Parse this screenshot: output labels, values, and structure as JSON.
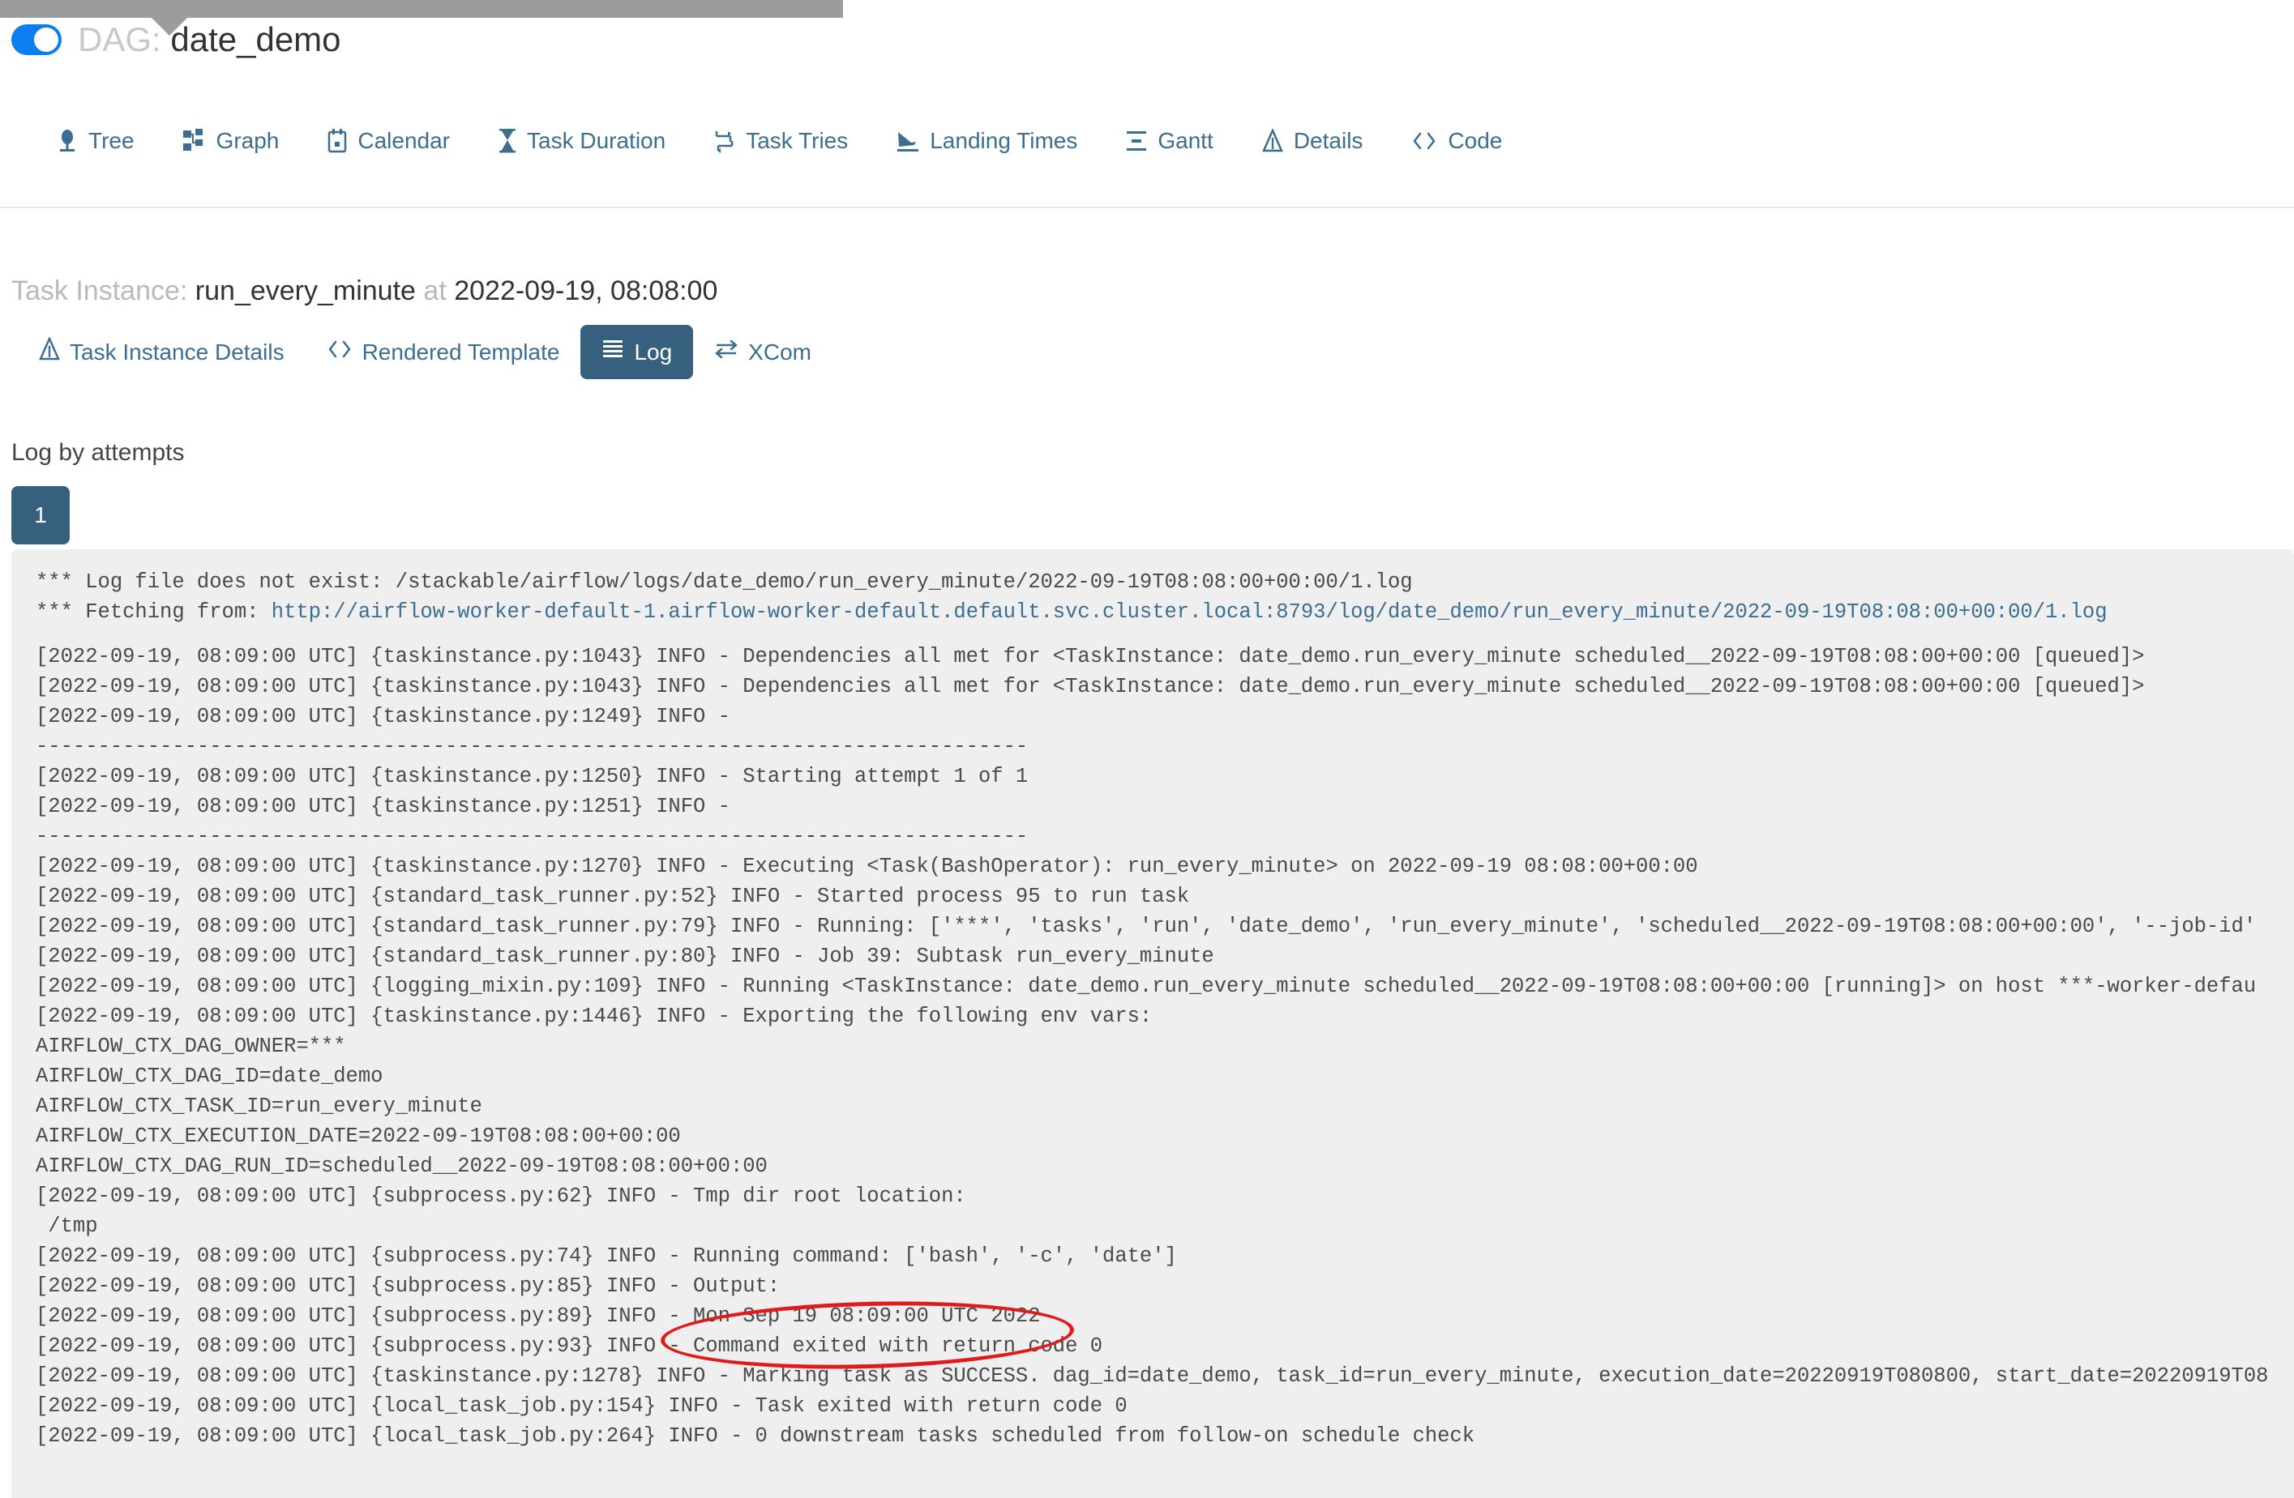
{
  "tooltip": {
    "visible": true
  },
  "dag": {
    "toggle_state": "on",
    "label_prefix": "DAG:",
    "name": "date_demo"
  },
  "nav_tabs": [
    {
      "label": "Tree",
      "icon": "tree-icon"
    },
    {
      "label": "Graph",
      "icon": "graph-icon"
    },
    {
      "label": "Calendar",
      "icon": "calendar-icon"
    },
    {
      "label": "Task Duration",
      "icon": "hourglass-icon"
    },
    {
      "label": "Task Tries",
      "icon": "retry-icon"
    },
    {
      "label": "Landing Times",
      "icon": "landing-icon"
    },
    {
      "label": "Gantt",
      "icon": "gantt-icon"
    },
    {
      "label": "Details",
      "icon": "triangle-icon"
    },
    {
      "label": "Code",
      "icon": "code-icon"
    }
  ],
  "task_instance": {
    "prefix": "Task Instance:",
    "task_id": "run_every_minute",
    "at_label": "at",
    "execution_date": "2022-09-19, 08:08:00"
  },
  "sub_tabs": [
    {
      "label": "Task Instance Details",
      "icon": "triangle-icon",
      "active": false
    },
    {
      "label": "Rendered Template",
      "icon": "code-icon",
      "active": false
    },
    {
      "label": "Log",
      "icon": "list-icon",
      "active": true
    },
    {
      "label": "XCom",
      "icon": "exchange-icon",
      "active": false
    }
  ],
  "log_section": {
    "title": "Log by attempts",
    "attempt_label": "1"
  },
  "log": {
    "header_lines": [
      {
        "prefix": "*** Log file does not exist: ",
        "link": "",
        "plain": "/stackable/airflow/logs/date_demo/run_every_minute/2022-09-19T08:08:00+00:00/1.log"
      },
      {
        "prefix": "*** Fetching from: ",
        "link": "http://airflow-worker-default-1.airflow-worker-default.default.svc.cluster.local:8793/log/date_demo/run_every_minute/2022-09-19T08:08:00+00:00/1.log",
        "plain": ""
      }
    ],
    "lines": [
      "[2022-09-19, 08:09:00 UTC] {taskinstance.py:1043} INFO - Dependencies all met for <TaskInstance: date_demo.run_every_minute scheduled__2022-09-19T08:08:00+00:00 [queued]>",
      "[2022-09-19, 08:09:00 UTC] {taskinstance.py:1043} INFO - Dependencies all met for <TaskInstance: date_demo.run_every_minute scheduled__2022-09-19T08:08:00+00:00 [queued]>",
      "[2022-09-19, 08:09:00 UTC] {taskinstance.py:1249} INFO - ",
      "--------------------------------------------------------------------------------",
      "[2022-09-19, 08:09:00 UTC] {taskinstance.py:1250} INFO - Starting attempt 1 of 1",
      "[2022-09-19, 08:09:00 UTC] {taskinstance.py:1251} INFO - ",
      "--------------------------------------------------------------------------------",
      "[2022-09-19, 08:09:00 UTC] {taskinstance.py:1270} INFO - Executing <Task(BashOperator): run_every_minute> on 2022-09-19 08:08:00+00:00",
      "[2022-09-19, 08:09:00 UTC] {standard_task_runner.py:52} INFO - Started process 95 to run task",
      "[2022-09-19, 08:09:00 UTC] {standard_task_runner.py:79} INFO - Running: ['***', 'tasks', 'run', 'date_demo', 'run_every_minute', 'scheduled__2022-09-19T08:08:00+00:00', '--job-id'",
      "[2022-09-19, 08:09:00 UTC] {standard_task_runner.py:80} INFO - Job 39: Subtask run_every_minute",
      "[2022-09-19, 08:09:00 UTC] {logging_mixin.py:109} INFO - Running <TaskInstance: date_demo.run_every_minute scheduled__2022-09-19T08:08:00+00:00 [running]> on host ***-worker-defau",
      "[2022-09-19, 08:09:00 UTC] {taskinstance.py:1446} INFO - Exporting the following env vars:",
      "AIRFLOW_CTX_DAG_OWNER=***",
      "AIRFLOW_CTX_DAG_ID=date_demo",
      "AIRFLOW_CTX_TASK_ID=run_every_minute",
      "AIRFLOW_CTX_EXECUTION_DATE=2022-09-19T08:08:00+00:00",
      "AIRFLOW_CTX_DAG_RUN_ID=scheduled__2022-09-19T08:08:00+00:00",
      "[2022-09-19, 08:09:00 UTC] {subprocess.py:62} INFO - Tmp dir root location: ",
      " /tmp",
      "[2022-09-19, 08:09:00 UTC] {subprocess.py:74} INFO - Running command: ['bash', '-c', 'date']",
      "[2022-09-19, 08:09:00 UTC] {subprocess.py:85} INFO - Output:",
      "[2022-09-19, 08:09:00 UTC] {subprocess.py:89} INFO - Mon Sep 19 08:09:00 UTC 2022",
      "[2022-09-19, 08:09:00 UTC] {subprocess.py:93} INFO - Command exited with return code 0",
      "[2022-09-19, 08:09:00 UTC] {taskinstance.py:1278} INFO - Marking task as SUCCESS. dag_id=date_demo, task_id=run_every_minute, execution_date=20220919T080800, start_date=20220919T08",
      "[2022-09-19, 08:09:00 UTC] {local_task_job.py:154} INFO - Task exited with return code 0",
      "[2022-09-19, 08:09:00 UTC] {local_task_job.py:264} INFO - 0 downstream tasks scheduled from follow-on schedule check"
    ]
  },
  "annotation": {
    "shape": "ellipse",
    "color": "#e01b1b",
    "highlighted_text": "Mon Sep 19 08:09:00 UTC 2022"
  },
  "colors": {
    "link": "#3b6e91",
    "active_tab_bg": "#37607f",
    "toggle_on": "#0d7ef0",
    "log_bg": "#efefef",
    "annotation": "#e01b1b"
  }
}
